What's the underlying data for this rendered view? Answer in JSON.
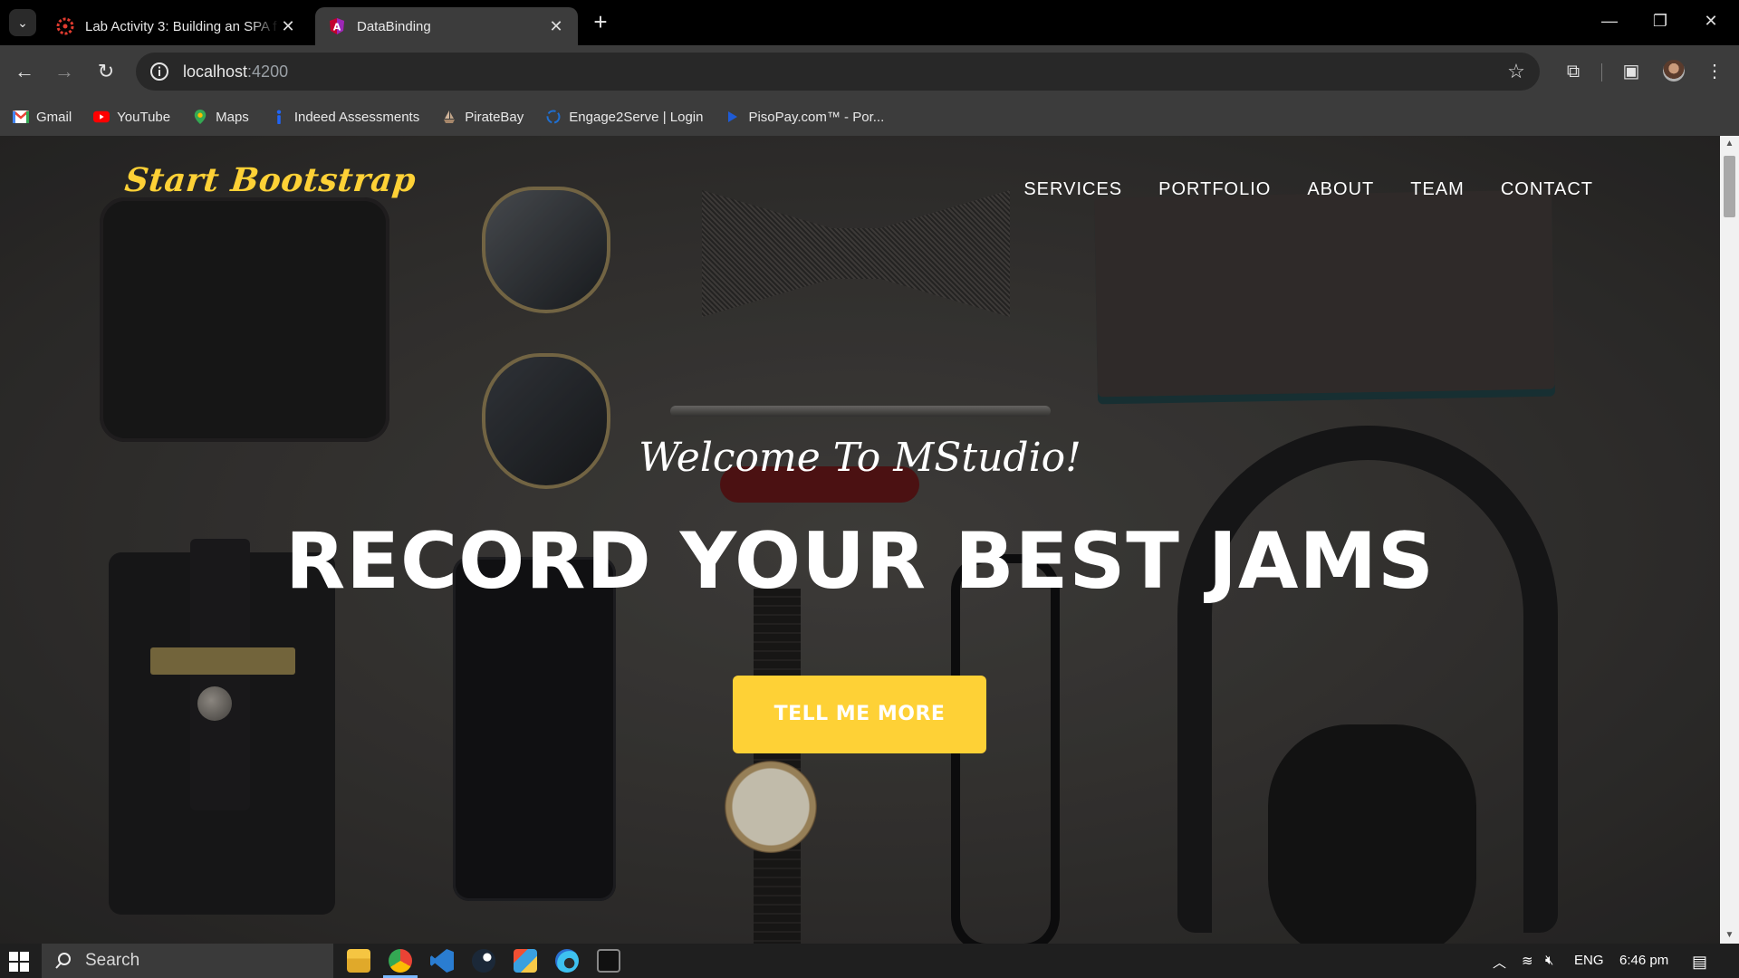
{
  "browser": {
    "tabs": [
      {
        "title": "Lab Activity 3: Building an SPA f",
        "active": false,
        "icon": "canvas-lms-icon"
      },
      {
        "title": "DataBinding",
        "active": true,
        "icon": "angular-icon"
      }
    ],
    "url_host": "localhost",
    "url_port": ":4200",
    "bookmarks": [
      {
        "label": "Gmail",
        "icon": "gmail-icon"
      },
      {
        "label": "YouTube",
        "icon": "youtube-icon"
      },
      {
        "label": "Maps",
        "icon": "maps-icon"
      },
      {
        "label": "Indeed Assessments",
        "icon": "indeed-icon"
      },
      {
        "label": "PirateBay",
        "icon": "ship-icon"
      },
      {
        "label": "Engage2Serve | Login",
        "icon": "engage2serve-icon"
      },
      {
        "label": "PisoPay.com™ - Por...",
        "icon": "pisopay-icon"
      }
    ]
  },
  "site": {
    "brand": "Start Bootstrap",
    "nav": [
      "SERVICES",
      "PORTFOLIO",
      "ABOUT",
      "TEAM",
      "CONTACT"
    ],
    "welcome": "Welcome To MStudio!",
    "headline": "RECORD YOUR BEST JAMS",
    "cta": "TELL ME MORE",
    "accent_color": "#fed136"
  },
  "taskbar": {
    "search_placeholder": "Search",
    "language": "ENG",
    "time": "6:46 pm",
    "apps": [
      "file-explorer-icon",
      "chrome-icon",
      "vscode-icon",
      "steam-icon",
      "git-icon",
      "edge-icon",
      "terminal-icon"
    ]
  }
}
